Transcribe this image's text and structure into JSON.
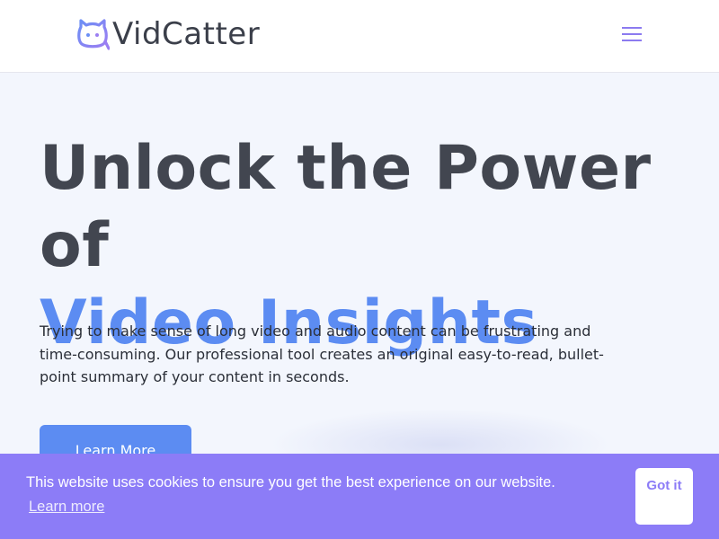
{
  "header": {
    "logo_text": "VidCatter",
    "menu_icon": "hamburger-menu-icon"
  },
  "hero": {
    "title_line1": "Unlock the Power of",
    "title_line2": "Video Insights",
    "description": "Trying to make sense of long video and audio content can be frustrating and time-consuming. Our professional tool creates an original easy-to-read, bullet-point summary of your content in seconds.",
    "learn_more_label": "Learn More"
  },
  "cookie_banner": {
    "message": "This website uses cookies to ensure you get the best experience on our website.",
    "learn_more_label": "Learn more",
    "got_it_label": "Got it"
  },
  "colors": {
    "accent_blue": "#5c8cf2",
    "accent_purple": "#8c7cf7",
    "heading_gray": "#424650",
    "background": "#f3f6fd"
  }
}
